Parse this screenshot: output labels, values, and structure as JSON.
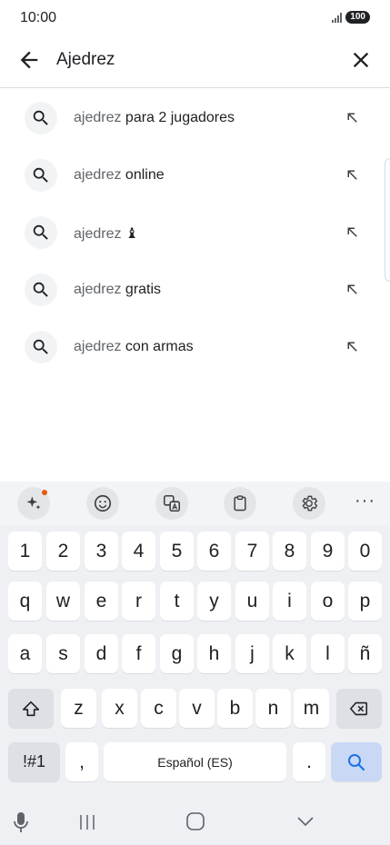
{
  "status_bar": {
    "time": "10:00",
    "battery": "100"
  },
  "search": {
    "query": "Ajedrez"
  },
  "suggestions": [
    {
      "query": "ajedrez",
      "suffix": " para 2 jugadores"
    },
    {
      "query": "ajedrez",
      "suffix": " online"
    },
    {
      "query": "ajedrez",
      "suffix": " ♝"
    },
    {
      "query": "ajedrez",
      "suffix": " gratis"
    },
    {
      "query": "ajedrez",
      "suffix": " con armas"
    }
  ],
  "keyboard": {
    "toolbar": [
      "ai-sparkle-icon",
      "emoji-icon",
      "translate-icon",
      "clipboard-icon",
      "settings-icon",
      "more-icon"
    ],
    "more_label": "···",
    "row_numbers": [
      "1",
      "2",
      "3",
      "4",
      "5",
      "6",
      "7",
      "8",
      "9",
      "0"
    ],
    "row_1": [
      "q",
      "w",
      "e",
      "r",
      "t",
      "y",
      "u",
      "i",
      "o",
      "p"
    ],
    "row_2": [
      "a",
      "s",
      "d",
      "f",
      "g",
      "h",
      "j",
      "k",
      "l",
      "ñ"
    ],
    "row_3": [
      "z",
      "x",
      "c",
      "v",
      "b",
      "n",
      "m"
    ],
    "symbols_label": "!#1",
    "comma_label": ",",
    "space_label": "Español (ES)",
    "period_label": "."
  },
  "colors": {
    "accent": "#1a73e8",
    "notification": "#e8590c",
    "keyboard_bg": "#eef0f3"
  }
}
